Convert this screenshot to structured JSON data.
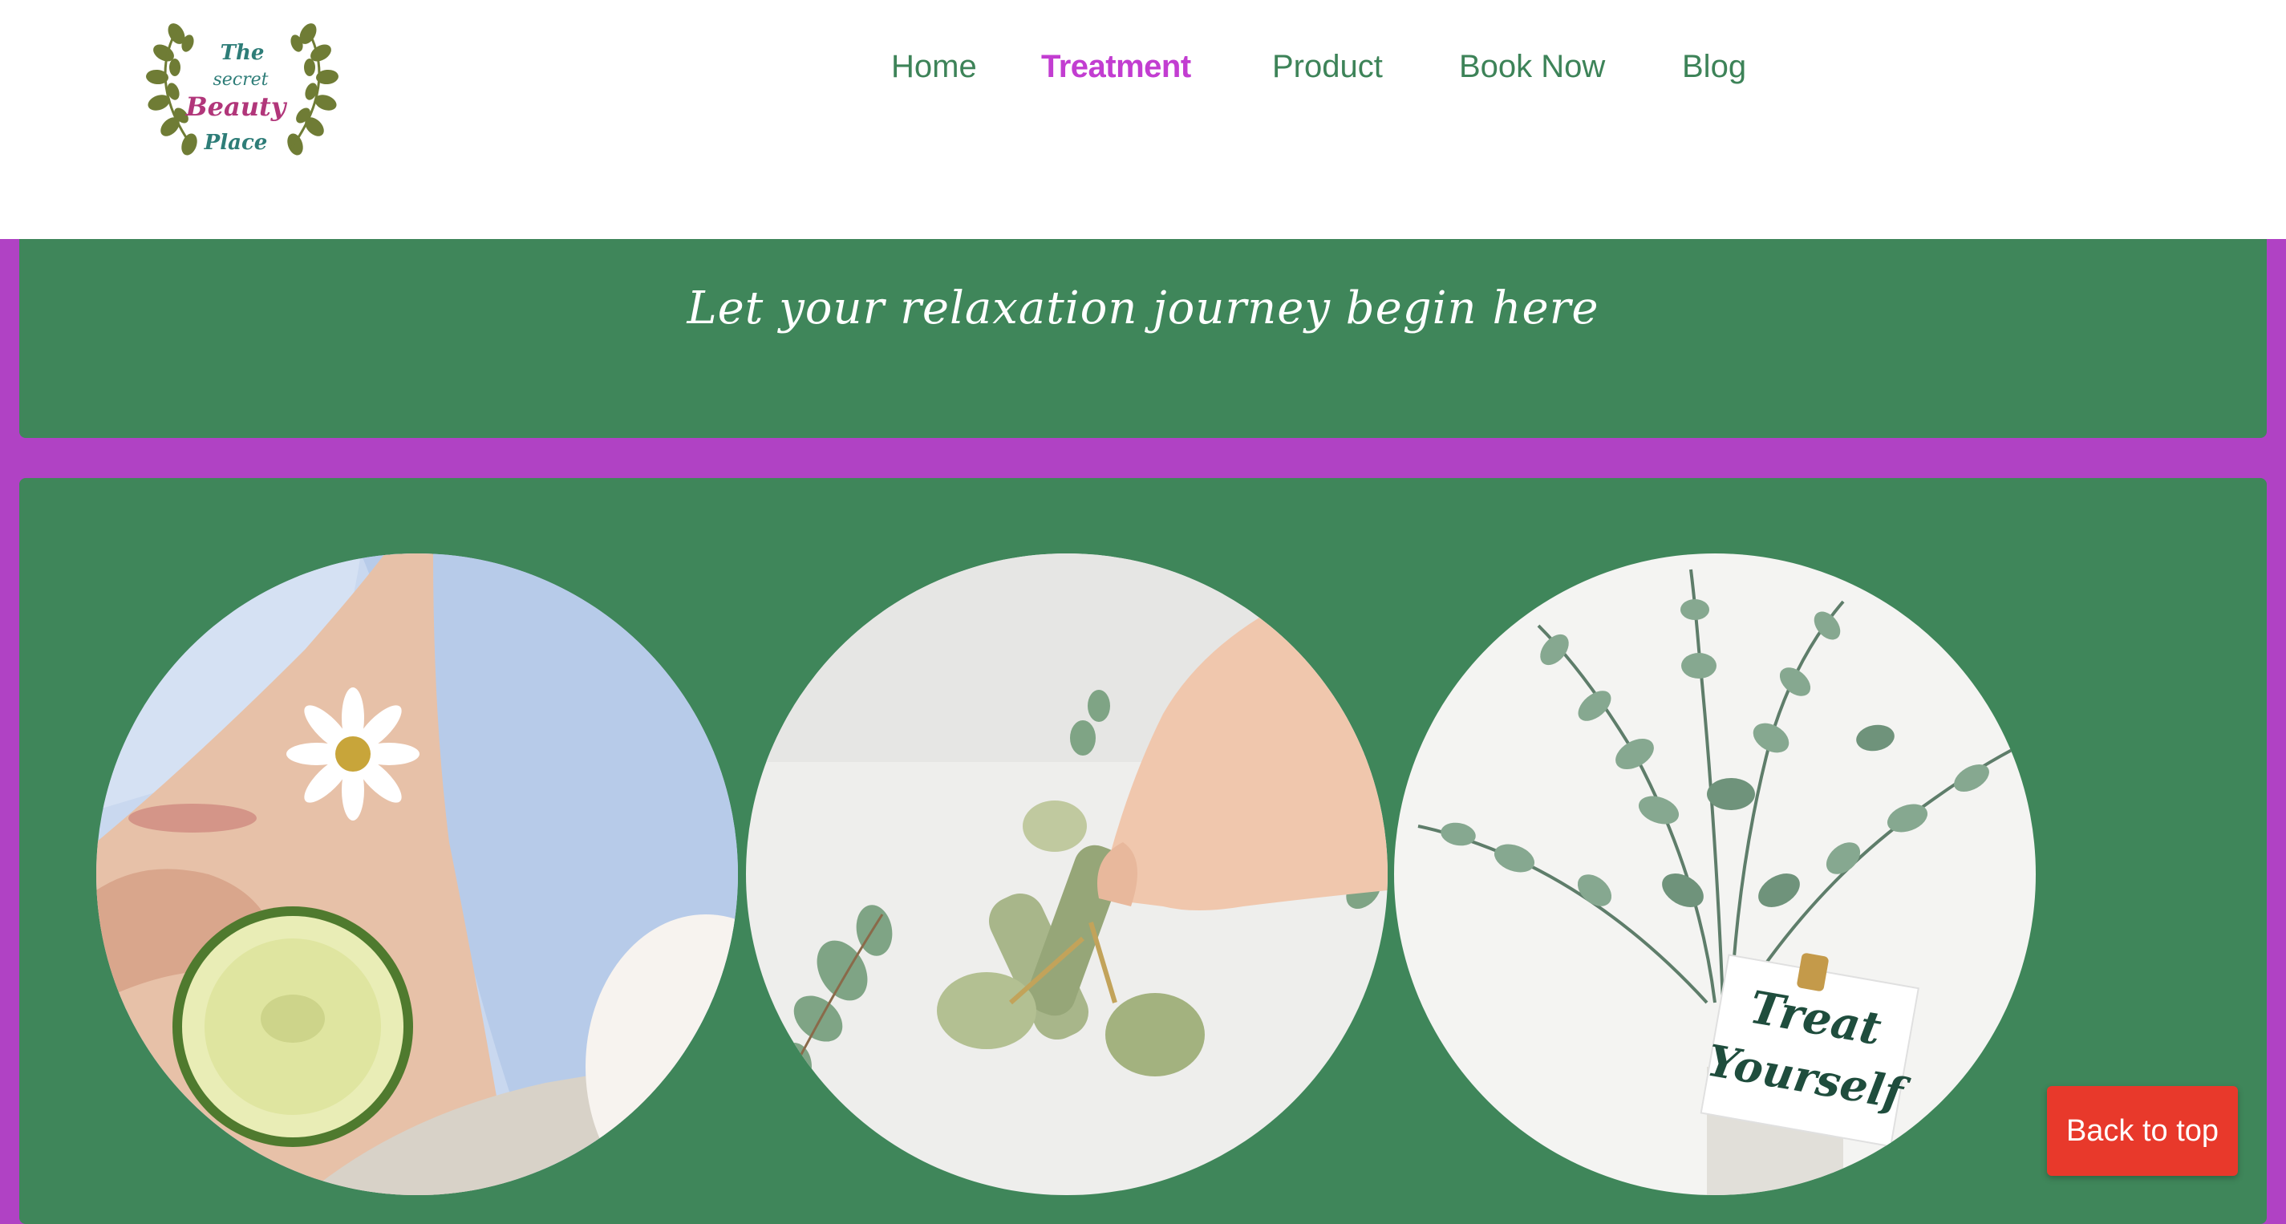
{
  "logo": {
    "line1": "The",
    "line2": "secret",
    "line3": "Beauty",
    "line4": "Place"
  },
  "nav": {
    "items": [
      {
        "label": "Home",
        "active": false
      },
      {
        "label": "Treatment",
        "active": true
      },
      {
        "label": "Product",
        "active": false
      },
      {
        "label": "Book Now",
        "active": false
      },
      {
        "label": "Blog",
        "active": false
      }
    ]
  },
  "banner": {
    "text": "Let your relaxation journey begin here"
  },
  "gallery": {
    "images": [
      {
        "name": "facial-cucumber-photo"
      },
      {
        "name": "jade-roller-photo"
      },
      {
        "name": "treat-yourself-eucalyptus-photo",
        "note_line1": "Treat",
        "note_line2": "Yourself"
      }
    ]
  },
  "back_to_top": {
    "label": "Back to top"
  },
  "colors": {
    "page_bg": "#b042c4",
    "header_bg": "#ffffff",
    "panel_green": "#3f865a",
    "nav_text": "#3d8358",
    "nav_active": "#c23dd1",
    "button_red": "#e8392b"
  }
}
